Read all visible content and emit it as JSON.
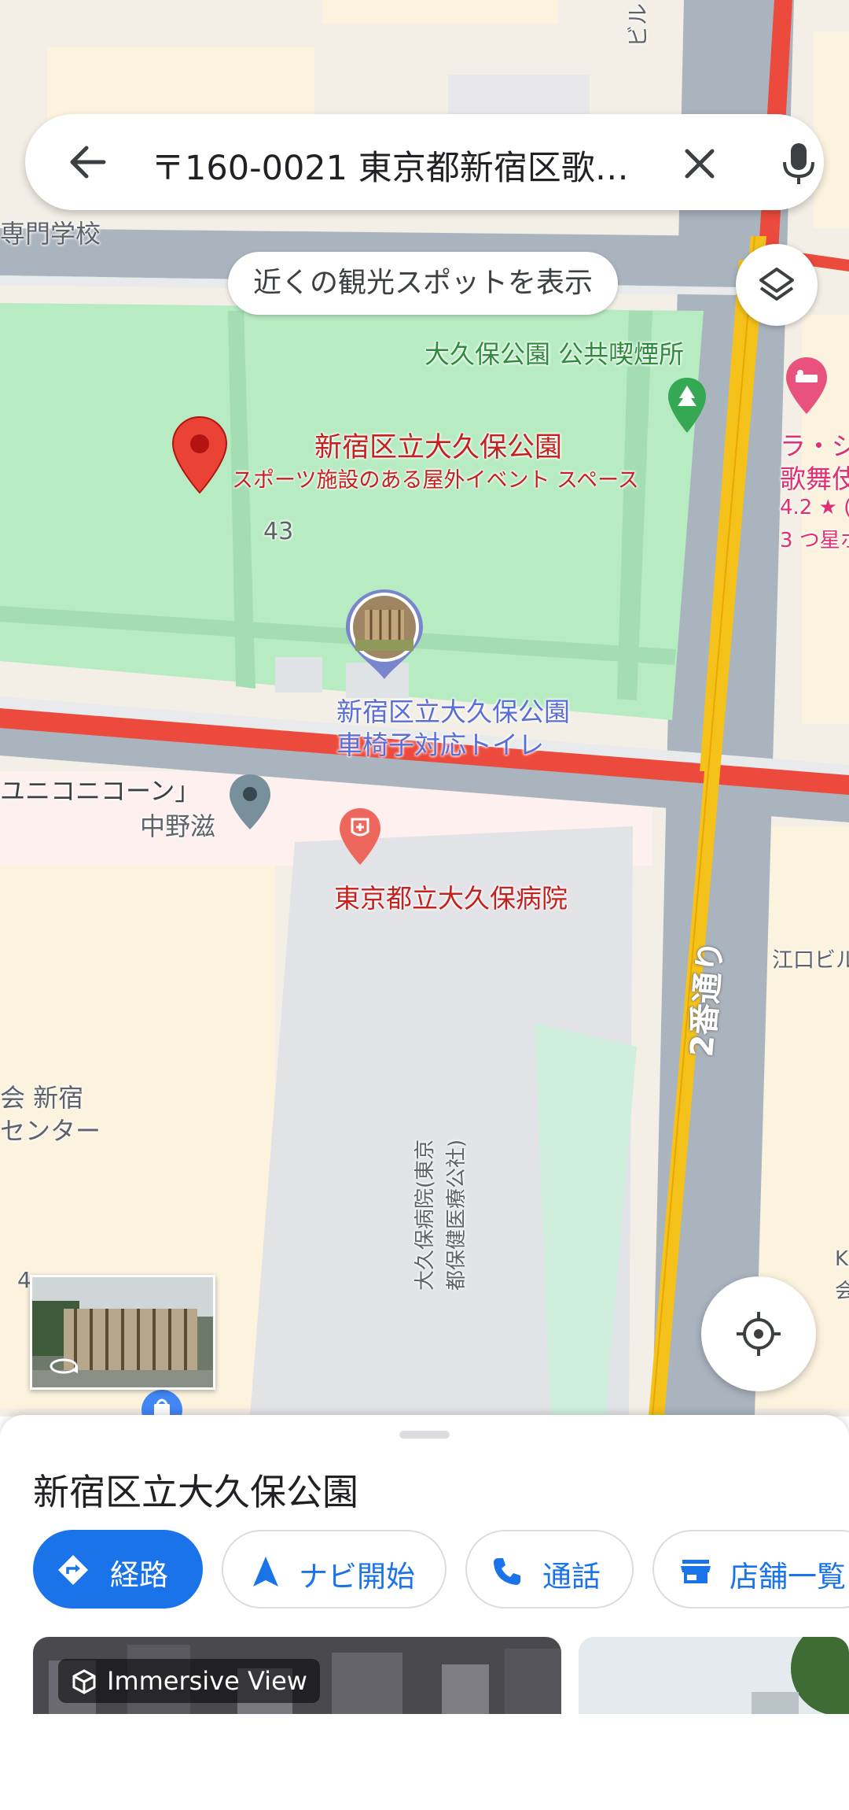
{
  "search": {
    "query": "〒160-0021 東京都新宿区歌…"
  },
  "chip": {
    "label": "近くの観光スポットを表示"
  },
  "map_labels": {
    "school": "専門学校",
    "building_top": "ビル",
    "smoking": "大久保公園 公共喫煙所",
    "park_name": "新宿区立大久保公園",
    "park_desc": "スポーツ施設のある屋外イベント スペース",
    "block_43": "43",
    "toilet_1": "新宿区立大久保公園",
    "toilet_2": "車椅子対応トイレ",
    "unicorn": "ユニコニコーン」",
    "nakano": "中野滋",
    "hospital": "東京都立大久保病院",
    "hotel_1": "ラ・ジ",
    "hotel_2": "歌舞伎",
    "hotel_rating": "4.2 ★ (",
    "hotel_stars": "3 つ星ホ",
    "street": "2番通り",
    "eguchi": "江口ビル",
    "center_1": "会 新宿",
    "center_2": "センター",
    "hospital_bldg_1": "大久保病院(東京",
    "hospital_bldg_2": "都保健医療公社)",
    "k_label": "K",
    "k_label2": "会",
    "num_4": "4"
  },
  "sheet": {
    "title": "新宿区立大久保公園",
    "actions": [
      "経路",
      "ナビ開始",
      "通話",
      "店舗一覧"
    ],
    "immersive": "Immersive View"
  },
  "colors": {
    "accent": "#1a73e8",
    "park": "#b7ebc2",
    "road_major": "#f2443a",
    "road_yellow": "#f8c21c",
    "pin": "#ea4335"
  },
  "icons": [
    "back-arrow-icon",
    "close-icon",
    "mic-icon",
    "layers-icon",
    "my-location-icon",
    "directions-icon",
    "navigation-icon",
    "phone-icon",
    "store-icon",
    "cube-icon",
    "rotate-360-icon",
    "shopping-bag-icon",
    "hospital-icon",
    "hotel-icon",
    "tree-icon",
    "map-pin-icon"
  ]
}
